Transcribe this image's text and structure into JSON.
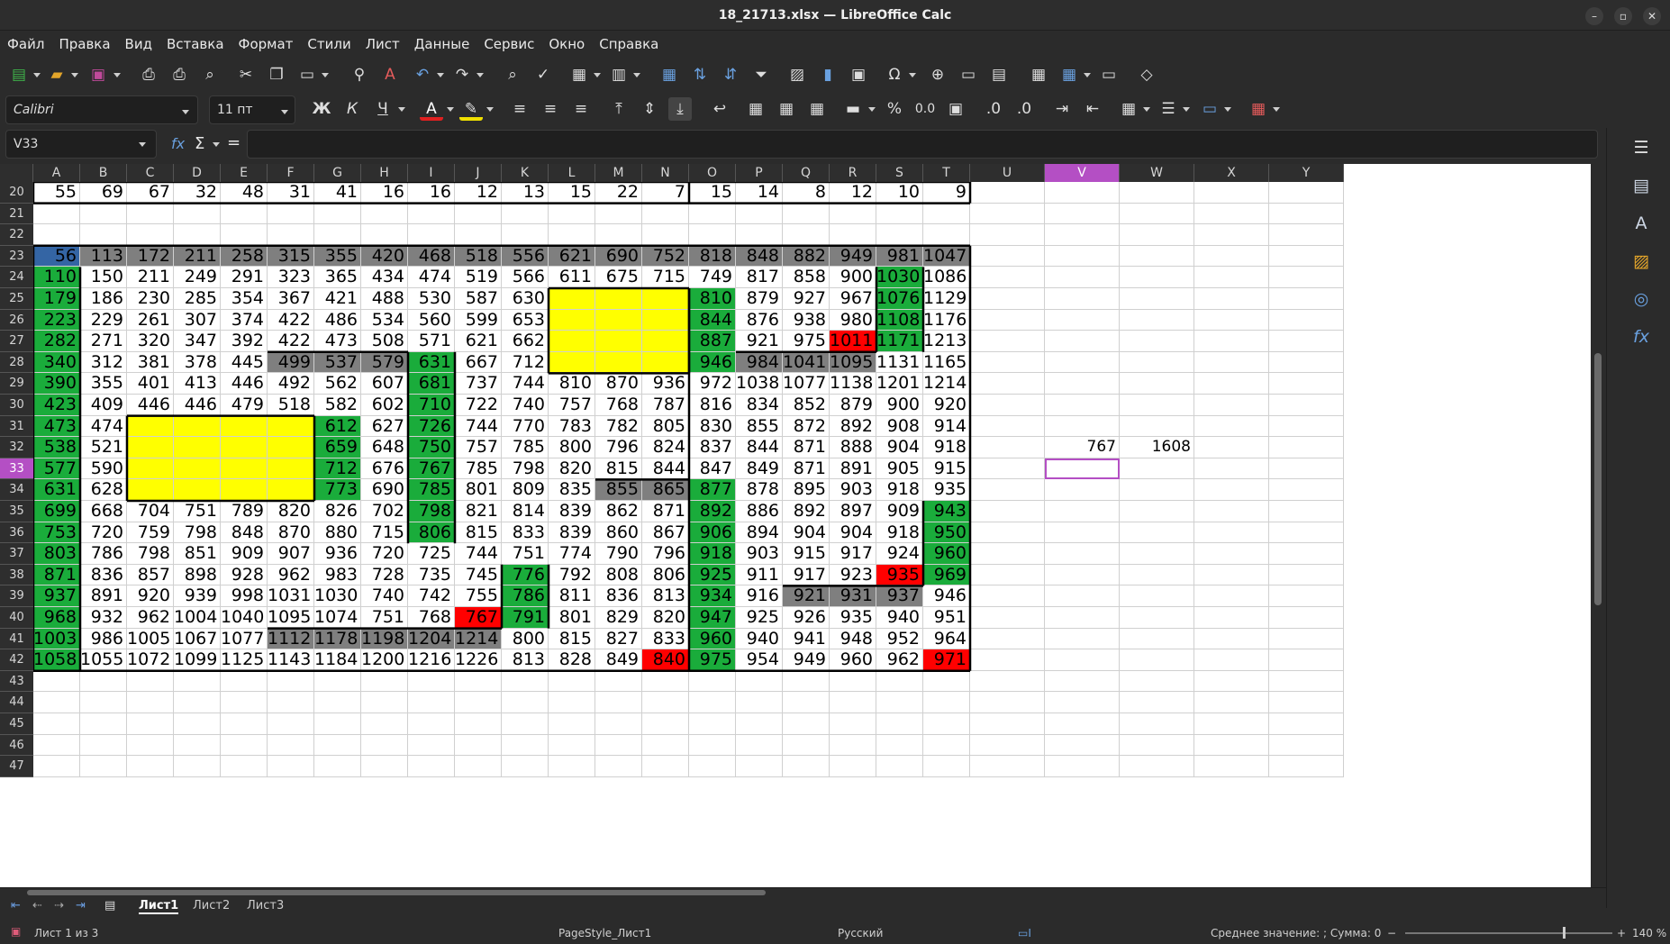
{
  "window": {
    "title": "18_21713.xlsx — LibreOffice Calc"
  },
  "menu": [
    "Файл",
    "Правка",
    "Вид",
    "Вставка",
    "Формат",
    "Стили",
    "Лист",
    "Данные",
    "Сервис",
    "Окно",
    "Справка"
  ],
  "toolbar2": {
    "font_name": "Calibri",
    "font_size": "11 пт",
    "bold": "Ж",
    "italic": "К",
    "underline": "Ч",
    "percent": "%",
    "decimals": "0.0"
  },
  "formula_bar": {
    "cell_ref": "V33",
    "fx": "fx",
    "sigma": "Σ",
    "equals": "=",
    "content": ""
  },
  "sheet": {
    "columns": [
      "A",
      "B",
      "C",
      "D",
      "E",
      "F",
      "G",
      "H",
      "I",
      "J",
      "K",
      "L",
      "M",
      "N",
      "O",
      "P",
      "Q",
      "R",
      "S",
      "T",
      "U",
      "V",
      "W",
      "X",
      "Y"
    ],
    "row_numbers": [
      20,
      21,
      22,
      23,
      24,
      25,
      26,
      27,
      28,
      29,
      30,
      31,
      32,
      33,
      34,
      35,
      36,
      37,
      38,
      39,
      40,
      41,
      42,
      43,
      44,
      45,
      46,
      47
    ],
    "selected_cell": "V33",
    "rows": {
      "20": [
        "55",
        "69",
        "67",
        "32",
        "48",
        "31",
        "41",
        "16",
        "16",
        "12",
        "13",
        "15",
        "22",
        "7",
        "15",
        "14",
        "8",
        "12",
        "10",
        "9"
      ],
      "23": [
        "56",
        "113",
        "172",
        "211",
        "258",
        "315",
        "355",
        "420",
        "468",
        "518",
        "556",
        "621",
        "690",
        "752",
        "818",
        "848",
        "882",
        "949",
        "981",
        "1047"
      ],
      "24": [
        "110",
        "150",
        "211",
        "249",
        "291",
        "323",
        "365",
        "434",
        "474",
        "519",
        "566",
        "611",
        "675",
        "715",
        "749",
        "817",
        "858",
        "900",
        "1030",
        "1086"
      ],
      "25": [
        "179",
        "186",
        "230",
        "285",
        "354",
        "367",
        "421",
        "488",
        "530",
        "587",
        "630",
        "",
        "",
        "",
        "810",
        "879",
        "927",
        "967",
        "1076",
        "1129"
      ],
      "26": [
        "223",
        "229",
        "261",
        "307",
        "374",
        "422",
        "486",
        "534",
        "560",
        "599",
        "653",
        "",
        "",
        "",
        "844",
        "876",
        "938",
        "980",
        "1108",
        "1176"
      ],
      "27": [
        "282",
        "271",
        "320",
        "347",
        "392",
        "422",
        "473",
        "508",
        "571",
        "621",
        "662",
        "",
        "",
        "",
        "887",
        "921",
        "975",
        "1011",
        "1171",
        "1213"
      ],
      "28": [
        "340",
        "312",
        "381",
        "378",
        "445",
        "499",
        "537",
        "579",
        "631",
        "667",
        "712",
        "",
        "",
        "",
        "946",
        "984",
        "1041",
        "1095",
        "1131",
        "1165"
      ],
      "29": [
        "390",
        "355",
        "401",
        "413",
        "446",
        "492",
        "562",
        "607",
        "681",
        "737",
        "744",
        "810",
        "870",
        "936",
        "972",
        "1038",
        "1077",
        "1138",
        "1201",
        "1214"
      ],
      "30": [
        "423",
        "409",
        "446",
        "446",
        "479",
        "518",
        "582",
        "602",
        "710",
        "722",
        "740",
        "757",
        "768",
        "787",
        "816",
        "834",
        "852",
        "879",
        "900",
        "920"
      ],
      "31": [
        "473",
        "474",
        "",
        "",
        "",
        "",
        "612",
        "627",
        "726",
        "744",
        "770",
        "783",
        "782",
        "805",
        "830",
        "855",
        "872",
        "892",
        "908",
        "914"
      ],
      "32": [
        "538",
        "521",
        "",
        "",
        "",
        "",
        "659",
        "648",
        "750",
        "757",
        "785",
        "800",
        "796",
        "824",
        "837",
        "844",
        "871",
        "888",
        "904",
        "918"
      ],
      "33": [
        "577",
        "590",
        "",
        "",
        "",
        "",
        "712",
        "676",
        "767",
        "785",
        "798",
        "820",
        "815",
        "844",
        "847",
        "849",
        "871",
        "891",
        "905",
        "915"
      ],
      "34": [
        "631",
        "628",
        "",
        "",
        "",
        "",
        "773",
        "690",
        "785",
        "801",
        "809",
        "835",
        "855",
        "865",
        "877",
        "878",
        "895",
        "903",
        "918",
        "935"
      ],
      "35": [
        "699",
        "668",
        "704",
        "751",
        "789",
        "820",
        "826",
        "702",
        "798",
        "821",
        "814",
        "839",
        "862",
        "871",
        "892",
        "886",
        "892",
        "897",
        "909",
        "943"
      ],
      "36": [
        "753",
        "720",
        "759",
        "798",
        "848",
        "870",
        "880",
        "715",
        "806",
        "815",
        "833",
        "839",
        "860",
        "867",
        "906",
        "894",
        "904",
        "904",
        "918",
        "950"
      ],
      "37": [
        "803",
        "786",
        "798",
        "851",
        "909",
        "907",
        "936",
        "720",
        "725",
        "744",
        "751",
        "774",
        "790",
        "796",
        "918",
        "903",
        "915",
        "917",
        "924",
        "960"
      ],
      "38": [
        "871",
        "836",
        "857",
        "898",
        "928",
        "962",
        "983",
        "728",
        "735",
        "745",
        "776",
        "792",
        "808",
        "806",
        "925",
        "911",
        "917",
        "923",
        "935",
        "969"
      ],
      "39": [
        "937",
        "891",
        "920",
        "939",
        "998",
        "1031",
        "1030",
        "740",
        "742",
        "755",
        "786",
        "811",
        "836",
        "813",
        "934",
        "916",
        "921",
        "931",
        "937",
        "946"
      ],
      "40": [
        "968",
        "932",
        "962",
        "1004",
        "1040",
        "1095",
        "1074",
        "751",
        "768",
        "767",
        "791",
        "801",
        "829",
        "820",
        "947",
        "925",
        "926",
        "935",
        "940",
        "951"
      ],
      "41": [
        "1003",
        "986",
        "1005",
        "1067",
        "1077",
        "1112",
        "1178",
        "1198",
        "1204",
        "1214",
        "800",
        "815",
        "827",
        "833",
        "960",
        "940",
        "941",
        "948",
        "952",
        "964"
      ],
      "42": [
        "1058",
        "1055",
        "1072",
        "1099",
        "1125",
        "1143",
        "1184",
        "1200",
        "1216",
        "1226",
        "813",
        "828",
        "849",
        "840",
        "975",
        "954",
        "949",
        "960",
        "962",
        "971"
      ]
    },
    "extra_cells": {
      "V32": "767",
      "W32": "1608"
    },
    "colors": {
      "green": "#1aac3b",
      "gray": "#7f7f7f",
      "yellow": "#ffff00",
      "red": "#ff0000",
      "blue": "#3465a4",
      "select": "#b44fc4"
    }
  },
  "sheet_tabs": [
    "Лист1",
    "Лист2",
    "Лист3"
  ],
  "status": {
    "sheet": "Лист 1 из 3",
    "page_style": "PageStyle_Лист1",
    "language": "Русский",
    "summary": "Среднее значение: ; Сумма: 0",
    "zoom": "140 %"
  }
}
